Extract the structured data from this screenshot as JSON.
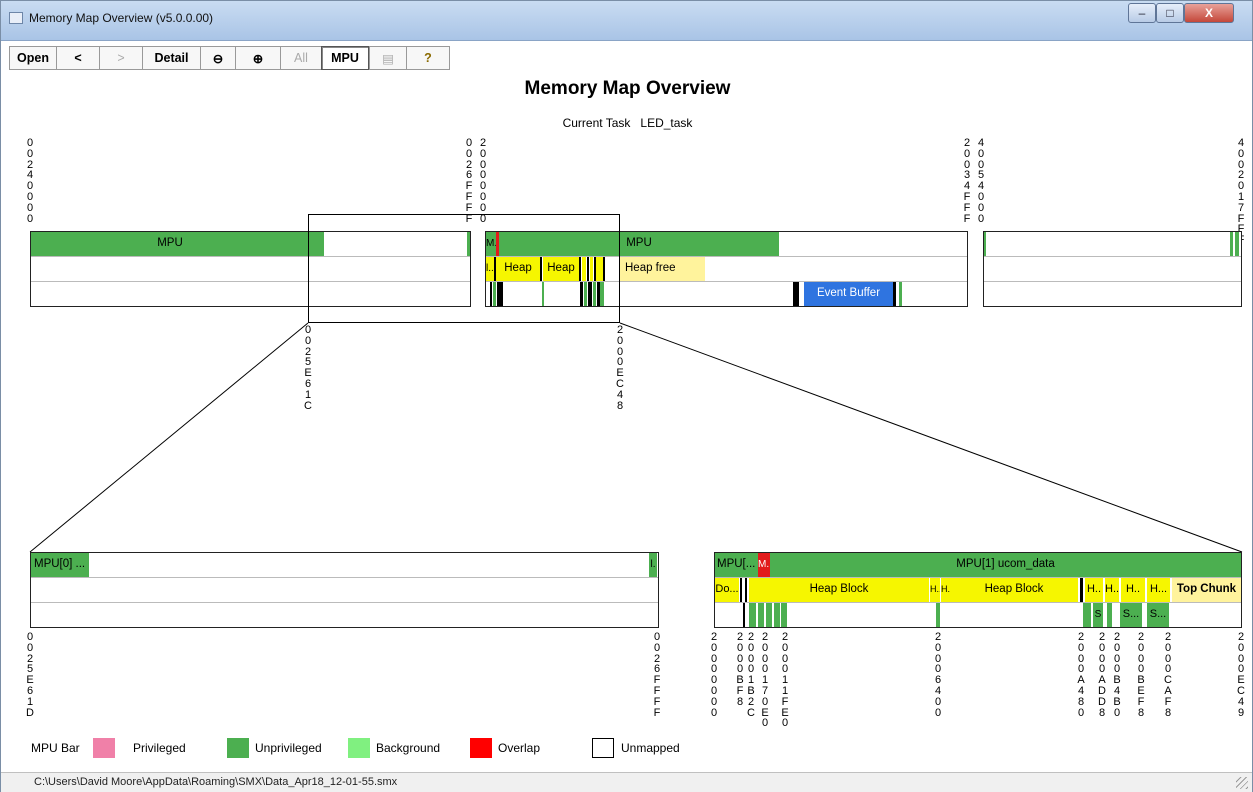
{
  "window": {
    "title": "Memory Map Overview   (v5.0.0.00)",
    "minimize": "–",
    "maximize": "□",
    "close": "X"
  },
  "toolbar": {
    "open": "Open",
    "back": "<",
    "forward": ">",
    "detail": "Detail",
    "zoom_out": "⊖",
    "zoom_in": "⊕",
    "all": "All",
    "mpu": "MPU",
    "doc": "▤",
    "help": "?"
  },
  "header": {
    "title": "Memory Map Overview",
    "task_label": "Current Task",
    "task_value": "LED_task"
  },
  "overview": {
    "addresses": [
      "00240000",
      "0026FFFF",
      "20000000",
      "20034FFF",
      "40054000",
      "4002017FFF"
    ],
    "region1": {
      "mpu_label": "MPU"
    },
    "region2": {
      "mpu_label": "MPU",
      "m_label": "M..",
      "heap1": "Heap",
      "heap2": "Heap",
      "heap_free": "Heap free",
      "dot_label": "l...",
      "event_buffer": "Event Buffer"
    },
    "zoom_start": "0025E61C",
    "zoom_end": "2000EC48"
  },
  "detail": {
    "left": {
      "mpu_label": "MPU[0] ...",
      "end_label": "l.",
      "addr_start": "0025E61D",
      "addr_end": "0026FFFF"
    },
    "right": {
      "mpu1": "MPU[...",
      "mpu_m": "M..",
      "mpu_main": "MPU[1] ucom_data",
      "do": "Do...",
      "heap_block1": "Heap Block",
      "h1": "H..",
      "h2": "H..",
      "heap_block2": "Heap Block",
      "h3": "H..",
      "h4": "H..",
      "h5": "H..",
      "h6": "H...",
      "top_chunk": "Top Chunk",
      "s1": "S",
      "s2": "S...",
      "s3": "S...",
      "addresses": [
        "20000000",
        "2000BF8",
        "20001B2C",
        "2000170E0",
        "200011FE0",
        "20006400",
        "2000A480",
        "2000ADD8",
        "2000B4B0",
        "2000BEF8",
        "2000CAF8",
        "2000EC49"
      ]
    }
  },
  "legend": {
    "title": "MPU Bar",
    "items": [
      {
        "label": "Privileged",
        "color": "#f080a8"
      },
      {
        "label": "Unprivileged",
        "color": "#4caf50"
      },
      {
        "label": "Background",
        "color": "#80f080"
      },
      {
        "label": "Overlap",
        "color": "#ff0000"
      },
      {
        "label": "Unmapped",
        "color": "#ffffff"
      }
    ]
  },
  "status": {
    "path": "C:\\Users\\David Moore\\AppData\\Roaming\\SMX\\Data_Apr18_12-01-55.smx"
  }
}
